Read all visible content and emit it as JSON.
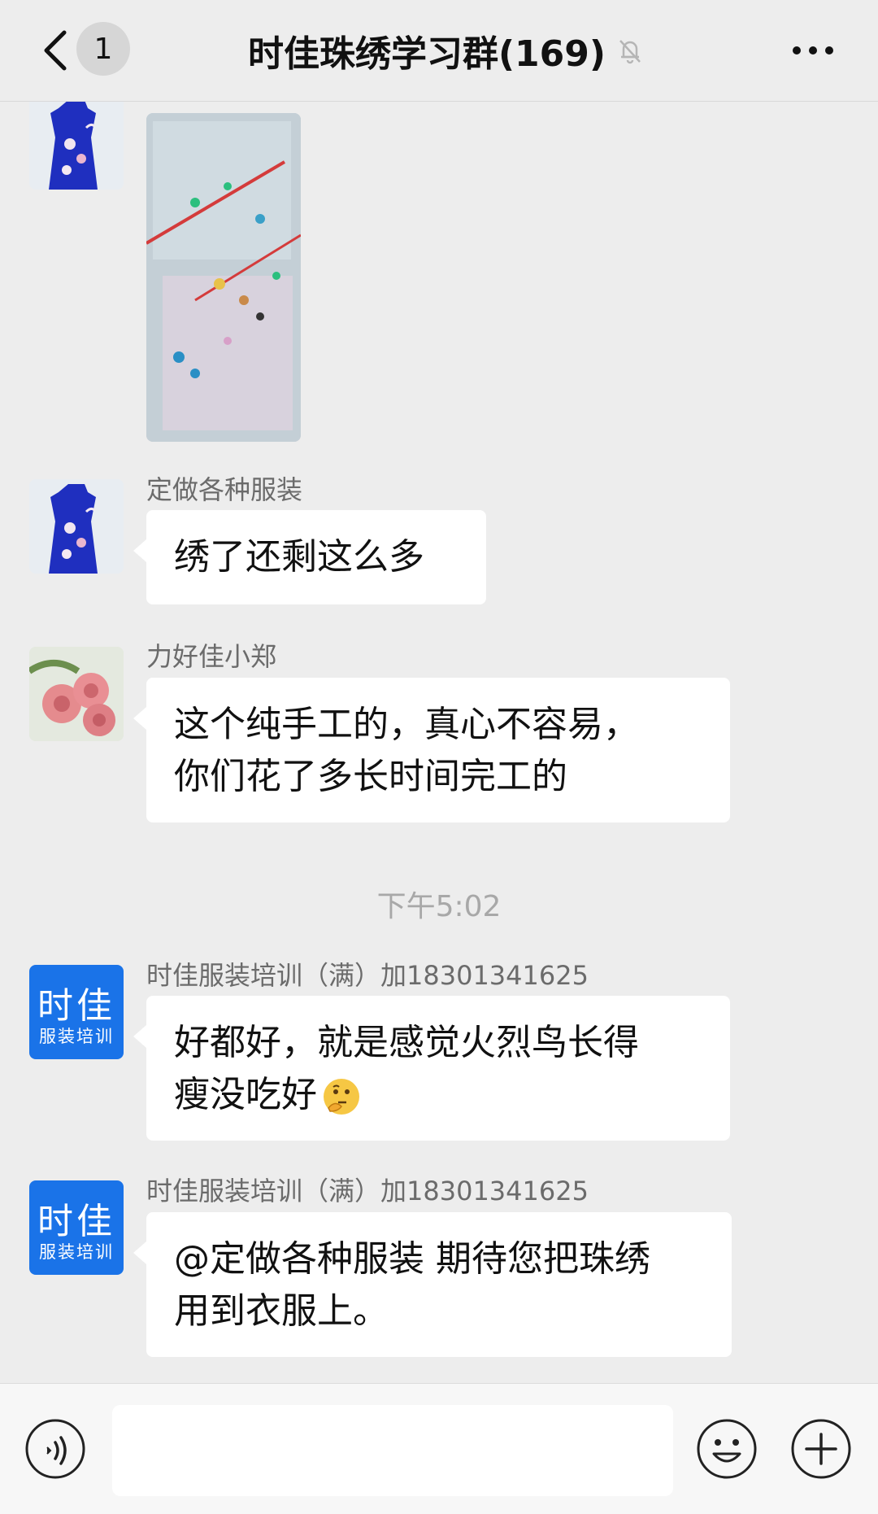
{
  "header": {
    "back_icon": "chevron-left-icon",
    "unread_count": "1",
    "title": "时佳珠绣学习群(169)",
    "mute_icon": "bell-muted-icon",
    "more_icon": "more-dots-icon"
  },
  "messages": [
    {
      "sender": "",
      "type": "image",
      "avatar": "dress"
    },
    {
      "sender": "定做各种服装",
      "type": "text",
      "avatar": "dress",
      "lines": [
        "绣了还剩这么多"
      ]
    },
    {
      "sender": "力好佳小郑",
      "type": "text",
      "avatar": "rose",
      "lines": [
        "这个纯手工的，真心不容易，",
        "你们花了多长时间完工的"
      ]
    },
    {
      "sender": "时佳服装培训（满）加18301341625",
      "type": "text",
      "avatar": "logo",
      "lines": [
        "好都好，就是感觉火烈鸟长得",
        "瘦没吃好"
      ],
      "emoji": "thinking-face-icon"
    },
    {
      "sender": "时佳服装培训（满）加18301341625",
      "type": "text",
      "avatar": "logo",
      "lines": [
        "@定做各种服装 期待您把珠绣",
        "用到衣服上。"
      ]
    }
  ],
  "timestamp": "下午5:02",
  "avatar_logo": {
    "top": "时佳",
    "bottom": "服装培训"
  },
  "input_bar": {
    "voice_icon": "voice-icon",
    "input_value": "",
    "emoji_icon": "emoji-icon",
    "plus_icon": "plus-icon"
  }
}
